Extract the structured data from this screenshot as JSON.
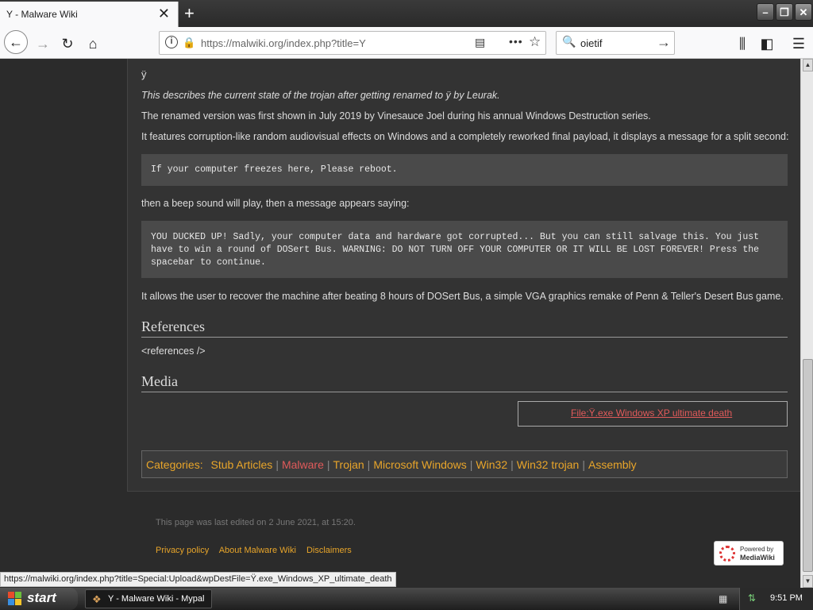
{
  "tab": {
    "title": "Y - Malware Wiki",
    "close": "✕"
  },
  "window": {
    "min": "–",
    "max": "❐",
    "close": "✕",
    "newtab": "+"
  },
  "nav": {
    "url": "https://malwiki.org/index.php?title=Y",
    "search_value": "oietif"
  },
  "article": {
    "title_char": "ÿ",
    "intro": "This describes the current state of the trojan after getting renamed to ÿ by Leurak.",
    "p1": "The renamed version was first shown in July 2019 by Vinesauce Joel during his annual Windows Destruction series.",
    "p2": "It features corruption-like random audiovisual effects on Windows and a completely reworked final payload, it displays a message for a split second:",
    "code1": "If your computer freezes here, Please reboot.",
    "p3": "then a beep sound will play, then a message appears saying:",
    "code2": "YOU DUCKED UP! Sadly, your computer data and hardware got corrupted... But you can still salvage this. You just have to win a round of DOSert Bus. WARNING: DO NOT TURN OFF YOUR COMPUTER OR IT WILL BE LOST FOREVER! Press the spacebar to continue.",
    "p4": "It allows the user to recover the machine after beating 8 hours of DOSert Bus, a simple VGA graphics remake of Penn & Teller's Desert Bus game.",
    "references_heading": "References",
    "references_text": "<references />",
    "media_heading": "Media",
    "media_link": "File:Ÿ.exe Windows XP ultimate death"
  },
  "categories": {
    "label": "Categories:",
    "items": [
      "Stub Articles",
      "Malware",
      "Trojan",
      "Microsoft Windows",
      "Win32",
      "Win32 trojan",
      "Assembly"
    ]
  },
  "footer": {
    "edited": "This page was last edited on 2 June 2021, at 15:20.",
    "links": [
      "Privacy policy",
      "About Malware Wiki",
      "Disclaimers"
    ],
    "badge_top": "Powered by",
    "badge_bottom": "MediaWiki"
  },
  "status_url": "https://malwiki.org/index.php?title=Special:Upload&wpDestFile=Ÿ.exe_Windows_XP_ultimate_death",
  "taskbar": {
    "start": "start",
    "task_label": "Y - Malware Wiki - Mypal",
    "clock": "9:51 PM"
  },
  "colors": {
    "accent_link": "#e8a52a",
    "red_link": "#e05a5a",
    "page_bg": "#2b2b2b"
  }
}
